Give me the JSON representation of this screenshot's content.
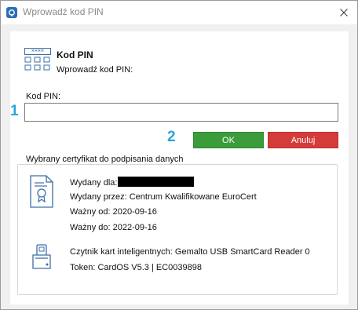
{
  "window": {
    "title": "Wprowadź kod PIN"
  },
  "header": {
    "title": "Kod PIN",
    "subtitle": "Wprowadź kod PIN:"
  },
  "pin": {
    "label": "Kod PIN:",
    "value": "",
    "step_number": "1"
  },
  "buttons": {
    "step_number": "2",
    "ok_label": "OK",
    "ok_color": "#3c9c3c",
    "cancel_label": "Anuluj",
    "cancel_color": "#d43b3b"
  },
  "certificate": {
    "legend": "Wybrany certyfikat do podpisania danych",
    "issued_to_label": "Wydany dla:",
    "issued_by": "Wydany przez: Centrum Kwalifikowane EuroCert",
    "valid_from": "Ważny od: 2020-09-16",
    "valid_to": "Ważny do: 2022-09-16",
    "reader": "Czytnik kart inteligentnych: Gemalto USB SmartCard Reader 0",
    "token": "Token: CardOS V5.3 | EC0039898"
  },
  "icons": {
    "app": "app-icon",
    "close": "close-icon",
    "keypad": "keypad-icon",
    "certificate": "certificate-icon",
    "reader": "smartcard-reader-icon"
  }
}
